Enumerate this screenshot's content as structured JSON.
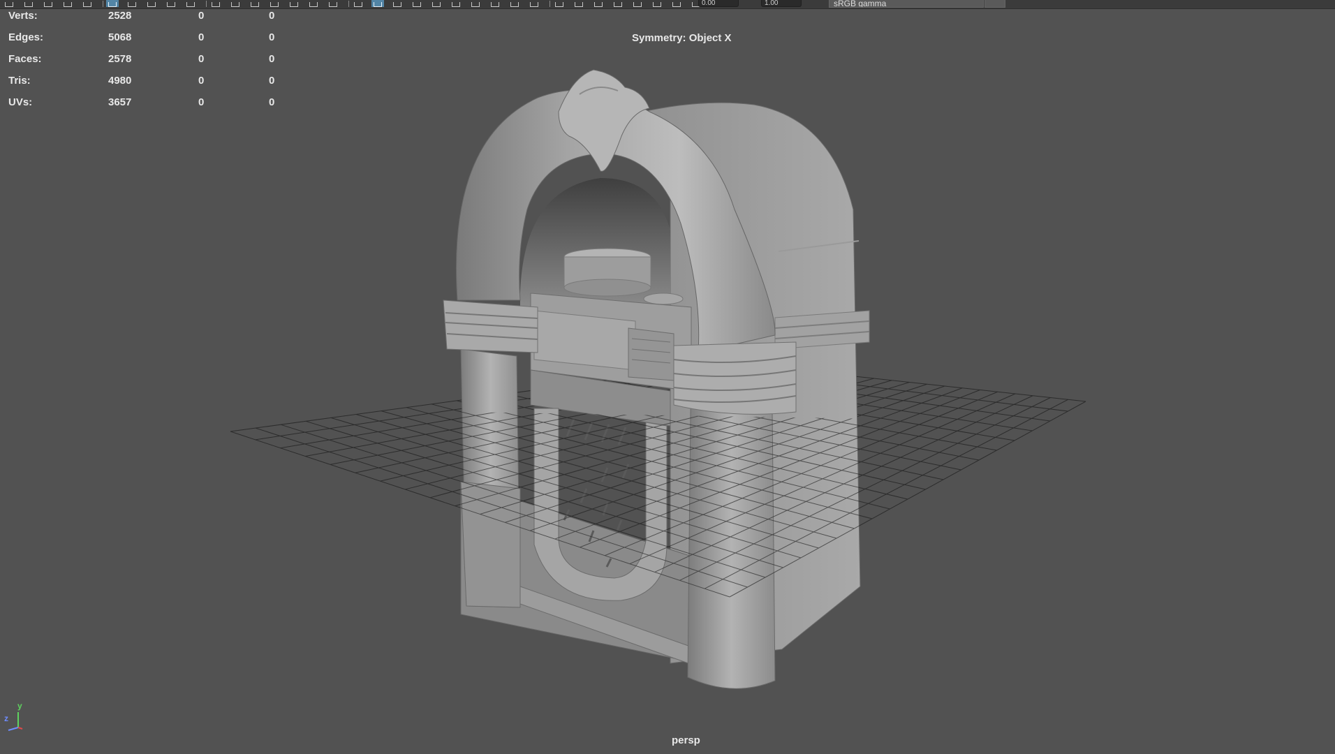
{
  "toolbar": {
    "icons": [
      "move-tool-icon",
      "lasso-icon",
      "paint-select-icon",
      "soft-select-icon",
      "magnet-icon",
      "snap-grid-icon",
      "snap-curve-icon",
      "snap-point-icon",
      "snap-view-icon",
      "snap-surface-icon",
      "history-icon",
      "input-icon",
      "output-icon",
      "render-icon",
      "ipr-icon",
      "render-settings-icon",
      "hypershade-icon",
      "wireframe-icon",
      "smooth-shade-icon",
      "textured-icon",
      "lights-icon",
      "shadows-icon",
      "ao-icon",
      "motion-blur-icon",
      "aa-icon",
      "xray-icon",
      "isolate-icon",
      "camera-icon",
      "gate-icon",
      "resolution-icon",
      "grid-toggle-icon",
      "safe-action-icon",
      "exposure-icon",
      "gamma-icon",
      "color-management-icon"
    ],
    "exposure_value": "0.00",
    "gamma_value": "1.00",
    "color_space": "sRGB gamma"
  },
  "hud": {
    "rows": [
      {
        "label": "Verts:",
        "v1": "2528",
        "v2": "0",
        "v3": "0"
      },
      {
        "label": "Edges:",
        "v1": "5068",
        "v2": "0",
        "v3": "0"
      },
      {
        "label": "Faces:",
        "v1": "2578",
        "v2": "0",
        "v3": "0"
      },
      {
        "label": "Tris:",
        "v1": "4980",
        "v2": "0",
        "v3": "0"
      },
      {
        "label": "UVs:",
        "v1": "3657",
        "v2": "0",
        "v3": "0"
      }
    ]
  },
  "symmetry": "Symmetry: Object X",
  "camera": "persp",
  "axes": {
    "y": "y",
    "z": "z"
  },
  "colors": {
    "viewport_bg": "#525252",
    "toolbar_bg": "#3b3b3b",
    "active_button": "#5285a6",
    "grid_line": "#2c2c2c",
    "mesh_light": "#a8a8a8",
    "mesh_mid": "#8e8e8e",
    "mesh_dark": "#5e5e5e"
  }
}
